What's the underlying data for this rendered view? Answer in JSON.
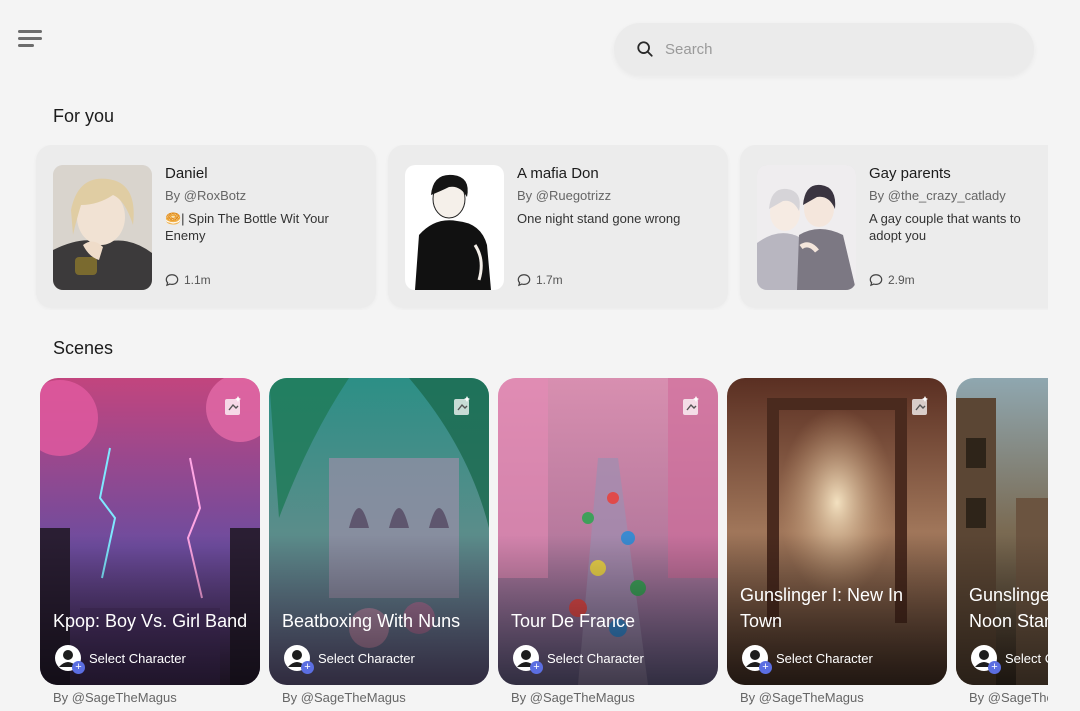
{
  "header": {
    "menu_icon": "hamburger-menu-icon",
    "search": {
      "placeholder": "Search",
      "value": "",
      "icon": "search-icon"
    }
  },
  "for_you": {
    "title": "For you",
    "cards": [
      {
        "name": "Daniel",
        "author": "By @RoxBotz",
        "description": "🥯| Spin The Bottle Wit Your Enemy",
        "chats": "1.1m",
        "chat_icon": "chat-bubble-icon"
      },
      {
        "name": "A mafia Don",
        "author": "By @Ruegotrizz",
        "description": "One night stand gone wrong",
        "chats": "1.7m",
        "chat_icon": "chat-bubble-icon"
      },
      {
        "name": "Gay parents",
        "author": "By @the_crazy_catlady",
        "description": "A gay couple that wants to adopt you",
        "chats": "2.9m",
        "chat_icon": "chat-bubble-icon"
      }
    ]
  },
  "scenes": {
    "title": "Scenes",
    "cards": [
      {
        "title": "Kpop: Boy Vs. Girl Band",
        "select_label": "Select Character",
        "author": "By @SageTheMagus"
      },
      {
        "title": "Beatboxing With Nuns",
        "select_label": "Select Character",
        "author": "By @SageTheMagus"
      },
      {
        "title": "Tour De France",
        "select_label": "Select Character",
        "author": "By @SageTheMagus"
      },
      {
        "title": "Gunslinger I: New In Town",
        "select_label": "Select Character",
        "author": "By @SageTheMagus"
      },
      {
        "title": "Gunslinger II: High Noon Standoff",
        "select_label": "Select Character",
        "author": "By @SageTheMagus"
      }
    ]
  },
  "colors": {
    "background": "#f4f4f4",
    "card": "#ececec",
    "accent_plus": "#5b6ee1"
  }
}
